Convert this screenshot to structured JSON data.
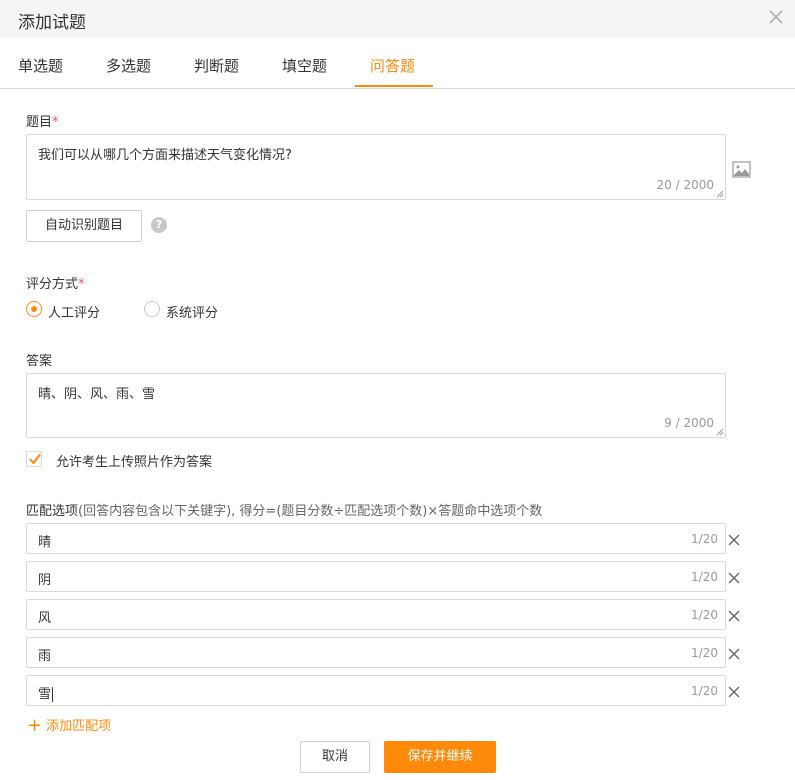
{
  "dialog": {
    "title": "添加试题"
  },
  "tabs": [
    {
      "label": "单选题",
      "active": false
    },
    {
      "label": "多选题",
      "active": false
    },
    {
      "label": "判断题",
      "active": false
    },
    {
      "label": "填空题",
      "active": false
    },
    {
      "label": "问答题",
      "active": true
    }
  ],
  "question": {
    "label": "题目",
    "required_mark": "*",
    "text": "我们可以从哪几个方面来描述天气变化情况?",
    "count": "20 / 2000",
    "auto_detect_button": "自动识别题目",
    "help_icon": "?"
  },
  "scoring": {
    "label": "评分方式",
    "required_mark": "*",
    "options": [
      {
        "label": "人工评分",
        "selected": true
      },
      {
        "label": "系统评分",
        "selected": false
      }
    ]
  },
  "answer": {
    "label": "答案",
    "text": "晴、阴、风、雨、雪",
    "count": "9 / 2000",
    "allow_photo_label": "允许考生上传照片作为答案",
    "allow_photo_checked": true
  },
  "match": {
    "title": "匹配选项",
    "note": "(回答内容包含以下关键字),  得分=(题目分数÷匹配选项个数)×答题命中选项个数",
    "items": [
      {
        "value": "晴",
        "count": "1/20"
      },
      {
        "value": "阴",
        "count": "1/20"
      },
      {
        "value": "风",
        "count": "1/20"
      },
      {
        "value": "雨",
        "count": "1/20"
      },
      {
        "value": "雪",
        "count": "1/20"
      }
    ],
    "add_label": "添加匹配项",
    "add_icon": "+"
  },
  "footer": {
    "cancel_label": "取消",
    "save_label": "保存并继续"
  },
  "colors": {
    "accent": "#ff8a0a",
    "required": "#ff4d4f"
  }
}
